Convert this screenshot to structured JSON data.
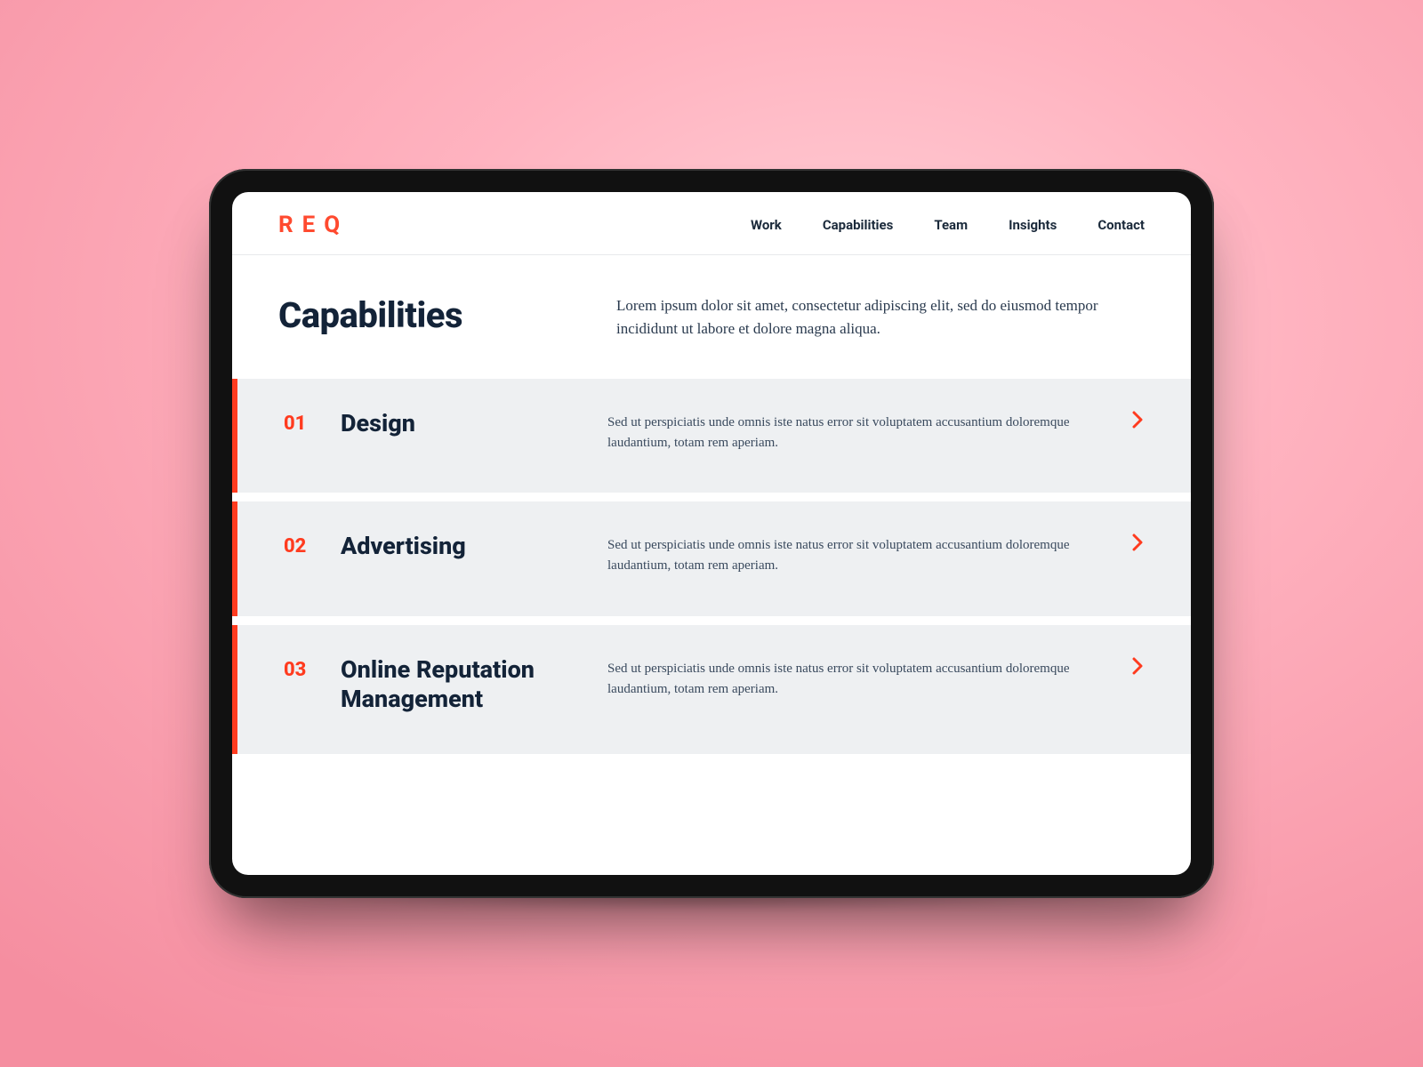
{
  "brand": {
    "logo_text": "REQ"
  },
  "nav": {
    "items": [
      {
        "label": "Work"
      },
      {
        "label": "Capabilities"
      },
      {
        "label": "Team"
      },
      {
        "label": "Insights"
      },
      {
        "label": "Contact"
      }
    ]
  },
  "hero": {
    "title": "Capabilities",
    "subtitle": "Lorem ipsum dolor sit amet, consectetur adipiscing elit, sed do eiusmod tempor incididunt ut labore et dolore magna aliqua."
  },
  "capabilities": [
    {
      "num": "01",
      "title": "Design",
      "desc": "Sed ut perspiciatis unde omnis iste natus error sit voluptatem accusantium doloremque laudantium, totam rem aperiam."
    },
    {
      "num": "02",
      "title": "Advertising",
      "desc": "Sed ut perspiciatis unde omnis iste natus error sit voluptatem accusantium doloremque laudantium, totam rem aperiam."
    },
    {
      "num": "03",
      "title": "Online Reputation Management",
      "desc": "Sed ut perspiciatis unde omnis iste natus error sit voluptatem accusantium doloremque laudantium, totam rem aperiam."
    }
  ],
  "colors": {
    "accent": "#ff3b1f",
    "ink": "#132338",
    "row_bg": "#eef0f2"
  }
}
